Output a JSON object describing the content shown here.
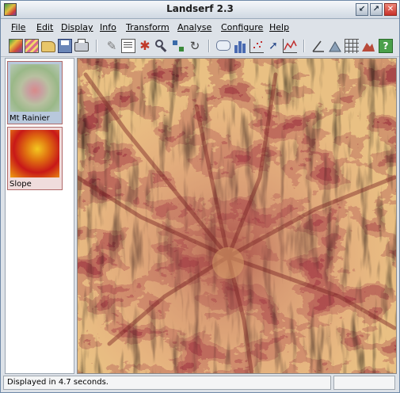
{
  "window": {
    "title": "Landserf 2.3"
  },
  "menu": [
    "File",
    "Edit",
    "Display",
    "Info",
    "Transform",
    "Analyse",
    "Configure",
    "Help"
  ],
  "toolbar": {
    "tools": [
      "open-raster-icon",
      "open-vector-icon",
      "open-folder-icon",
      "save-icon",
      "print-icon",
      "edit-pencil-icon",
      "text-info-icon",
      "transform-icon",
      "zoom-icon",
      "pan-icon",
      "refresh-icon",
      "speech-icon",
      "histogram-icon",
      "scatterplot-icon",
      "dotplot-icon",
      "query-arrow-icon",
      "line-graph-icon",
      "angle-icon",
      "feature-icon",
      "grid-icon",
      "peak-icon",
      "help-icon"
    ]
  },
  "sidebar": {
    "items": [
      {
        "label": "Mt Rainier",
        "selected": true
      },
      {
        "label": "Slope",
        "selected": false
      }
    ]
  },
  "colors": {
    "accent": "#c8302a",
    "selection": "#5a7a9e"
  },
  "status": {
    "message": "Displayed in 4.7 seconds."
  }
}
